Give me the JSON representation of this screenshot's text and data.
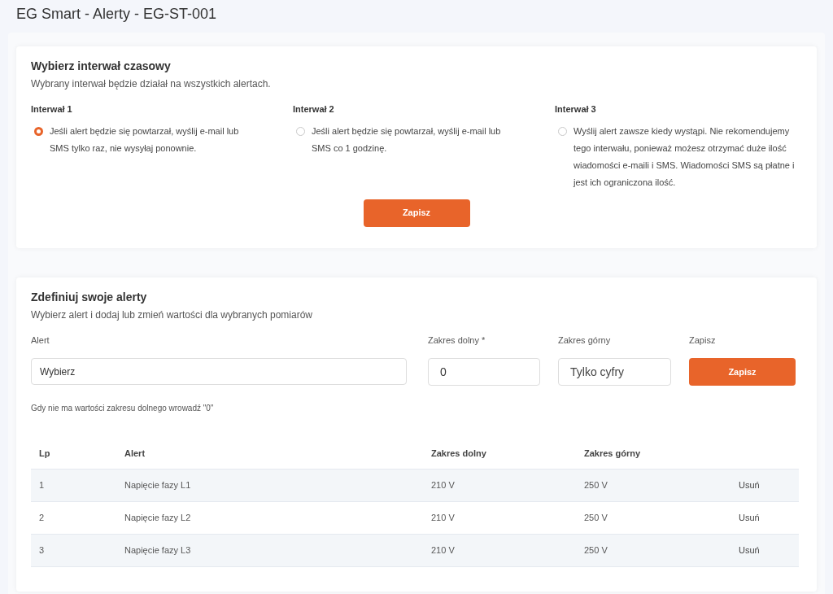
{
  "page_title": "EG Smart - Alerty - EG-ST-001",
  "interval_card": {
    "title": "Wybierz interwał czasowy",
    "subtitle": "Wybrany interwał będzie działał na wszystkich alertach.",
    "options": [
      {
        "label": "Interwał 1",
        "text": "Jeśli alert będzie się powtarzał, wyślij e-mail lub SMS tylko raz, nie wysyłaj ponownie.",
        "selected": true
      },
      {
        "label": "Interwał 2",
        "text": "Jeśli alert będzie się powtarzał, wyślij e-mail lub SMS co 1 godzinę.",
        "selected": false
      },
      {
        "label": "Interwał 3",
        "text": "Wyślij alert zawsze kiedy wystąpi. Nie rekomendujemy tego interwału, ponieważ możesz otrzymać duże ilość wiadomości e-maili i SMS. Wiadomości SMS są płatne i jest ich ograniczona ilość.",
        "selected": false
      }
    ],
    "save_button": "Zapisz"
  },
  "alerts_card": {
    "title": "Zdefiniuj swoje alerty",
    "subtitle": "Wybierz alert i dodaj lub zmień wartości dla wybranych pomiarów",
    "alert_field": {
      "label": "Alert",
      "value": "Wybierz"
    },
    "lower_field": {
      "label": "Zakres dolny *",
      "value": "0"
    },
    "upper_field": {
      "label": "Zakres górny",
      "placeholder": "Tylko cyfry"
    },
    "save_label": "Zapisz",
    "save_button": "Zapisz",
    "hint": "Gdy nie ma wartości zakresu dolnego wrowadź \"0\"",
    "table": {
      "columns": [
        "Lp",
        "Alert",
        "Zakres dolny",
        "Zakres górny"
      ],
      "rows": [
        {
          "lp": "1",
          "alert": "Napięcie fazy L1",
          "lower": "210 V",
          "upper": "250 V",
          "action": "Usuń"
        },
        {
          "lp": "2",
          "alert": "Napięcie fazy L2",
          "lower": "210 V",
          "upper": "250 V",
          "action": "Usuń"
        },
        {
          "lp": "3",
          "alert": "Napięcie fazy L3",
          "lower": "210 V",
          "upper": "250 V",
          "action": "Usuń"
        }
      ]
    }
  }
}
